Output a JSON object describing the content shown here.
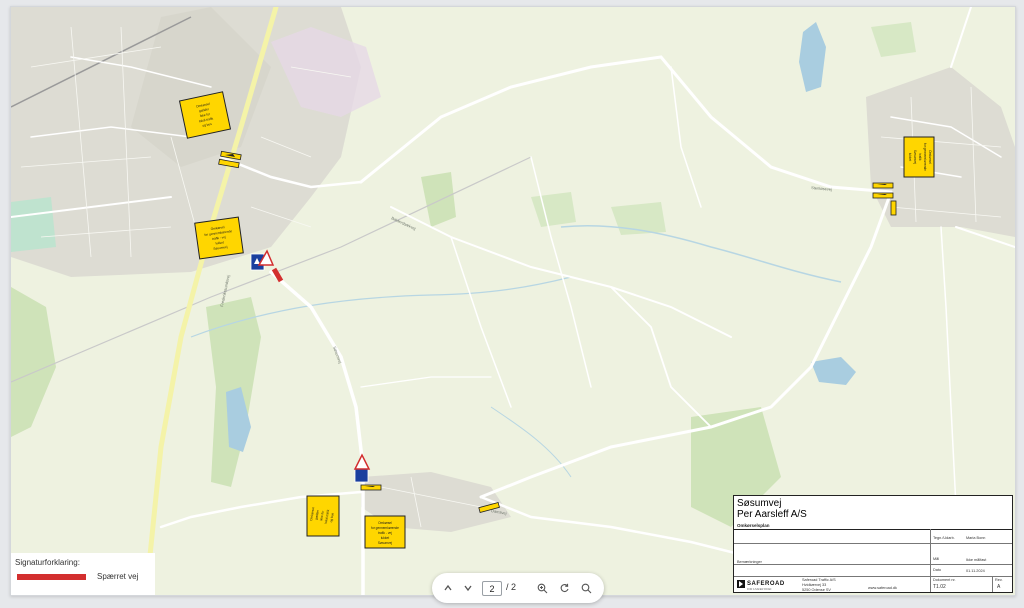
{
  "map": {
    "signs": [
      {
        "id": "sign-1",
        "lines": [
          "Omkørsel",
          "gælder",
          "ikke for",
          "lokal trafik",
          "og bus"
        ]
      },
      {
        "id": "sign-2",
        "lines": [
          "Omkørsel",
          "for gennemkørende",
          "trafik - vej",
          "lukket",
          "Søsumvej"
        ]
      },
      {
        "id": "sign-3",
        "lines": [
          "Omkørsel",
          "for gennemkørende",
          "trafik",
          "Søsumvej",
          "lukket"
        ]
      },
      {
        "id": "sign-4",
        "lines": [
          "Omkørsel",
          "gælder",
          "ikke for",
          "lokal trafik",
          "og bus"
        ]
      },
      {
        "id": "sign-5",
        "lines": [
          "Omkørsel",
          "for gennemkørende",
          "trafik - vej",
          "lukket",
          "Søsumvej"
        ]
      }
    ],
    "colors": {
      "closed_road": "#d32f2f",
      "sign_yellow": "#ffd600",
      "land": "#eef2e0",
      "urban": "#dcdcd2",
      "water": "#a9cde0",
      "forest": "#c9dfb4",
      "road": "#ffffff"
    }
  },
  "legend": {
    "title": "Signaturforklaring:",
    "items": [
      {
        "label": "Spærret vej",
        "color": "#d32f2f"
      }
    ]
  },
  "title_block": {
    "project": "Søsumvej",
    "client": "Per Aarsleff A/S",
    "doc_type": "Omkørselsplan",
    "drawn_label": "Tegn./Udarb.",
    "drawn_value": "Maria Bonn",
    "remarks_label": "Bemærkninger",
    "scale_label": "Mål",
    "scale_value": "Ikke målfast",
    "date_label": "Dato",
    "date_value": "01.11.2024",
    "docno_label": "Dokument nr.",
    "docno_value": "T1.02",
    "rev_label": "Rev.",
    "rev_value": "A",
    "brand": "SAFEROAD",
    "brand_sub": "FOR A SAFER ROAD",
    "company": "Saferoad Traffic A/S",
    "address1": "Hvidkærvej 33",
    "address2": "5250 Odense SV",
    "website": "www.saferoad.dk"
  },
  "toolbar": {
    "current_page": "2",
    "total_pages": "/ 2"
  }
}
